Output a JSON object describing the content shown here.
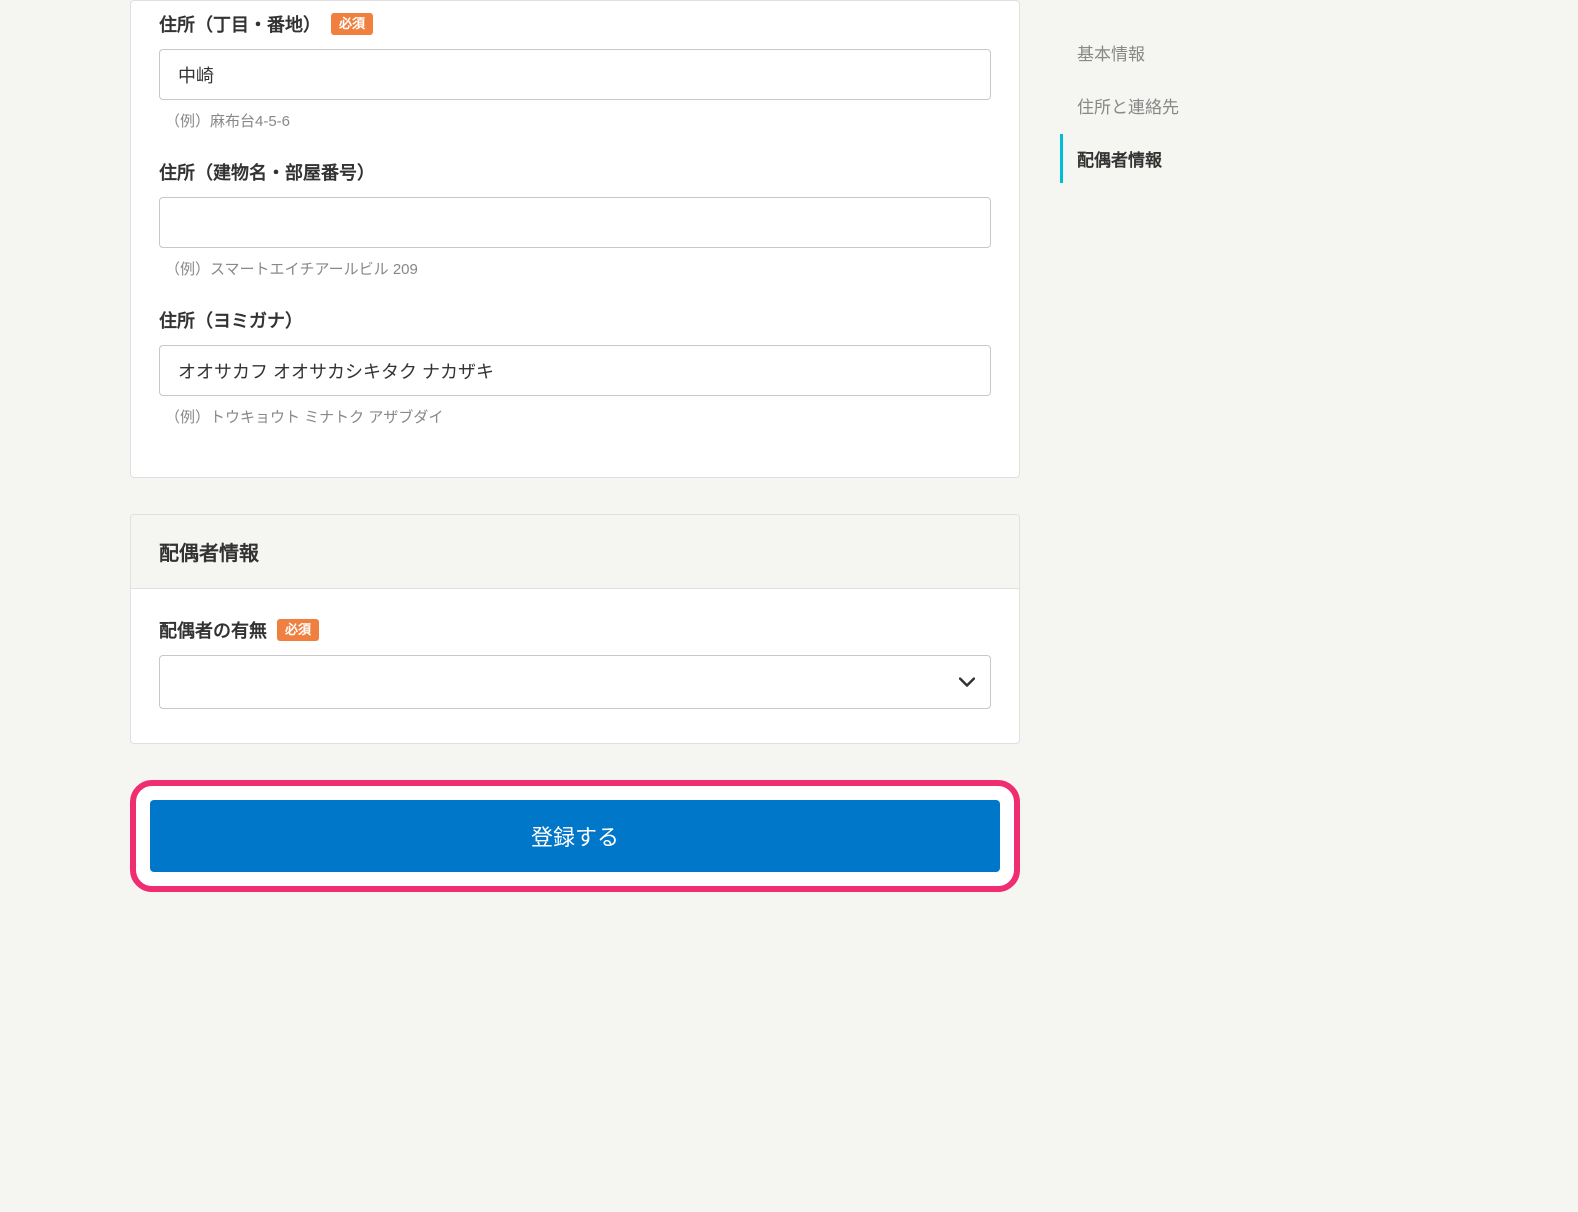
{
  "address": {
    "street": {
      "label": "住所（丁目・番地）",
      "required": "必須",
      "value": "中崎",
      "help": "（例）麻布台4-5-6"
    },
    "building": {
      "label": "住所（建物名・部屋番号）",
      "value": "",
      "help": "（例）スマートエイチアールビル 209"
    },
    "yomi": {
      "label": "住所（ヨミガナ）",
      "value": "オオサカフ オオサカシキタク ナカザキ",
      "help": "（例）トウキョウト ミナトク アザブダイ"
    }
  },
  "spouse": {
    "section_title": "配偶者情報",
    "presence": {
      "label": "配偶者の有無",
      "required": "必須",
      "value": ""
    }
  },
  "submit": {
    "label": "登録する"
  },
  "sidebar": {
    "items": [
      {
        "label": "基本情報",
        "active": false
      },
      {
        "label": "住所と連絡先",
        "active": false
      },
      {
        "label": "配偶者情報",
        "active": true
      }
    ]
  }
}
